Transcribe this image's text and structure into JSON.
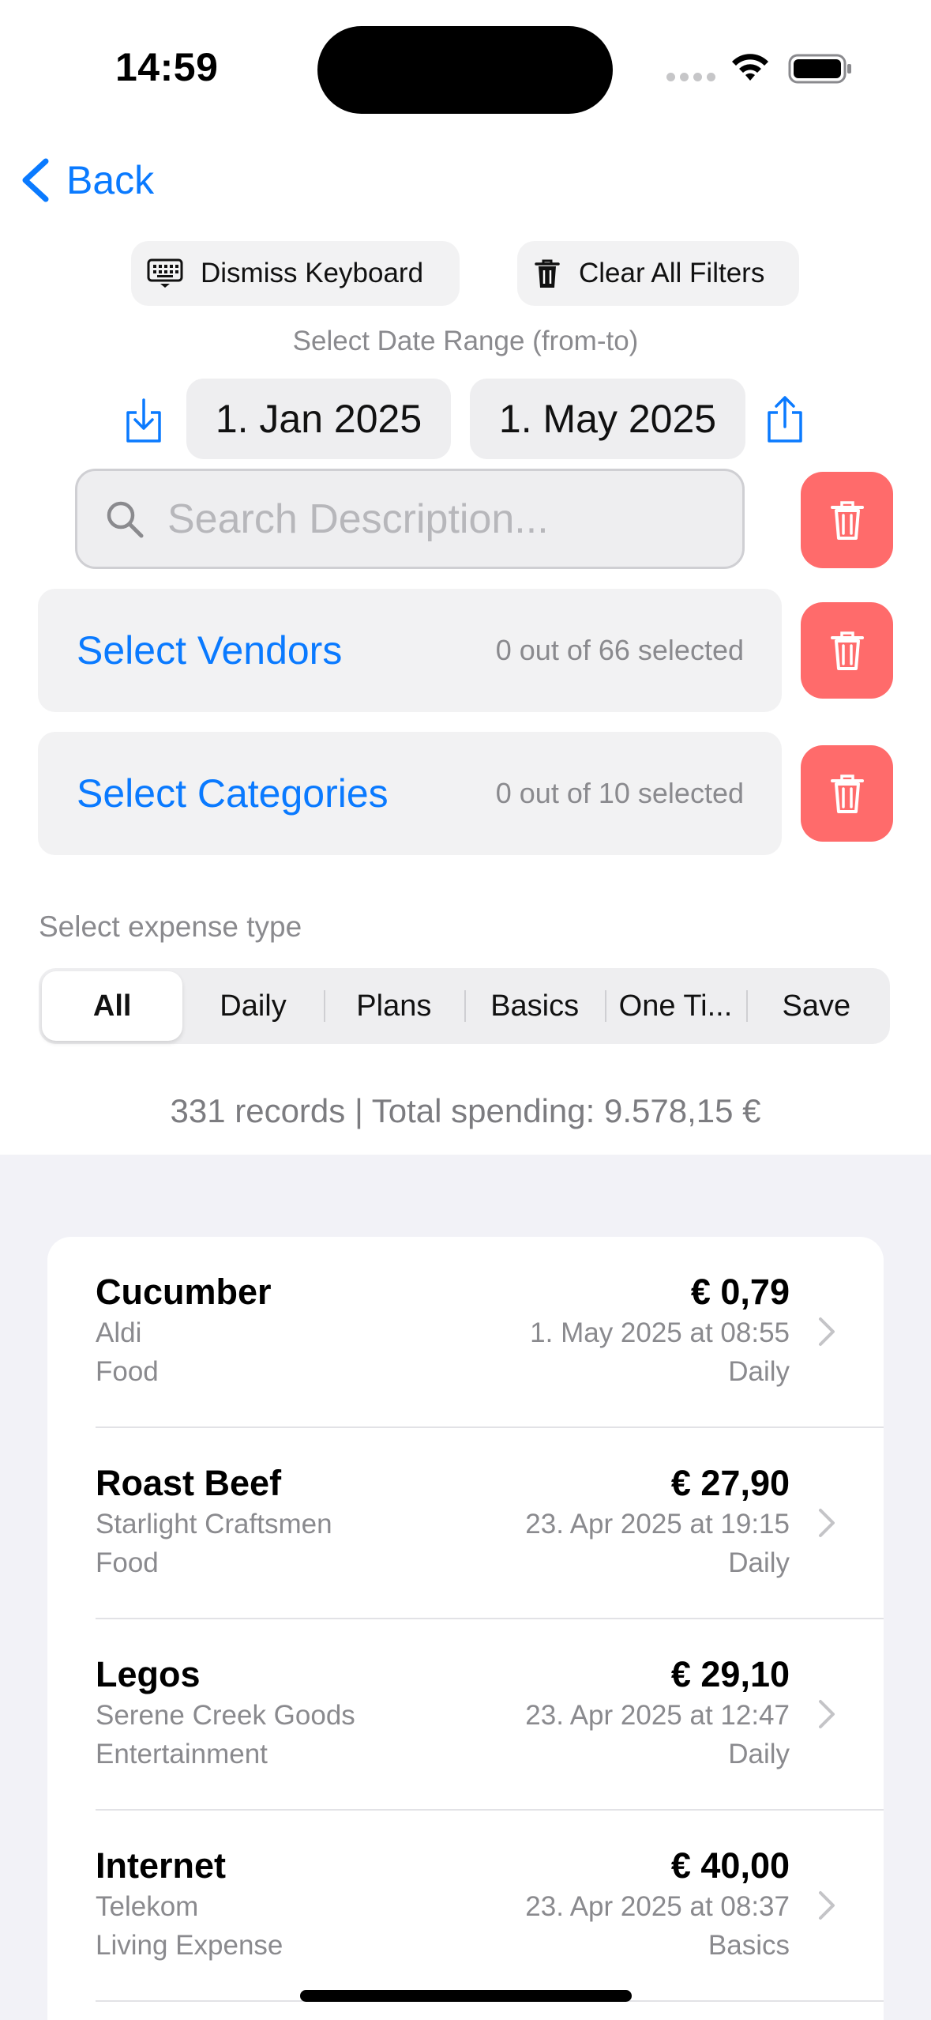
{
  "status_bar": {
    "time": "14:59"
  },
  "nav": {
    "back_label": "Back"
  },
  "toolbar": {
    "dismiss_keyboard": "Dismiss Keyboard",
    "clear_filters": "Clear All Filters"
  },
  "date_range": {
    "label": "Select Date Range (from-to)",
    "from": "1. Jan 2025",
    "to": "1. May 2025"
  },
  "search": {
    "placeholder": "Search Description..."
  },
  "vendors": {
    "label": "Select Vendors",
    "count": "0 out of 66 selected"
  },
  "categories": {
    "label": "Select Categories",
    "count": "0 out of 10 selected"
  },
  "expense_type": {
    "label": "Select expense type",
    "options": [
      "All",
      "Daily",
      "Plans",
      "Basics",
      "One Ti...",
      "Save"
    ],
    "selected": "All"
  },
  "summary": "331 records | Total spending: 9.578,15 €",
  "expenses": [
    {
      "name": "Cucumber",
      "vendor": "Aldi",
      "category": "Food",
      "amount": "€ 0,79",
      "date": "1. May 2025 at 08:55",
      "type": "Daily"
    },
    {
      "name": "Roast Beef",
      "vendor": "Starlight Craftsmen",
      "category": "Food",
      "amount": "€ 27,90",
      "date": "23. Apr 2025 at 19:15",
      "type": "Daily"
    },
    {
      "name": "Legos",
      "vendor": "Serene Creek Goods",
      "category": "Entertainment",
      "amount": "€ 29,10",
      "date": "23. Apr 2025 at 12:47",
      "type": "Daily"
    },
    {
      "name": "Internet",
      "vendor": "Telekom",
      "category": "Living Expense",
      "amount": "€ 40,00",
      "date": "23. Apr 2025 at 08:37",
      "type": "Basics"
    }
  ],
  "colors": {
    "accent": "#0a7aff",
    "delete": "#ff6b6b",
    "background": "#f2f2f7"
  }
}
